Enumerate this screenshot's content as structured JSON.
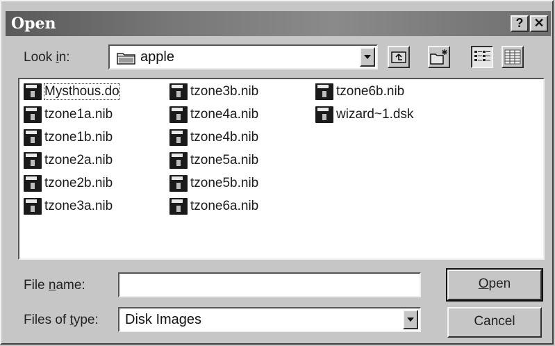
{
  "window": {
    "title": "Open",
    "help_button": "?",
    "close_button": "✕"
  },
  "look_in": {
    "label_prefix": "Look ",
    "label_underlined": "i",
    "label_suffix": "n:",
    "value": "apple",
    "folder_icon": "folder-icon"
  },
  "toolbar": {
    "up_folder_icon": "up-folder-icon",
    "new_folder_icon": "new-folder-icon",
    "list_view_icon": "list-view-icon",
    "details_view_icon": "details-view-icon",
    "list_view_pressed": true
  },
  "files": {
    "columns": [
      [
        "Mysthous.do",
        "tzone1a.nib",
        "tzone1b.nib",
        "tzone2a.nib",
        "tzone2b.nib",
        "tzone3a.nib"
      ],
      [
        "tzone3b.nib",
        "tzone4a.nib",
        "tzone4b.nib",
        "tzone5a.nib",
        "tzone5b.nib",
        "tzone6a.nib"
      ],
      [
        "tzone6b.nib",
        "wizard~1.dsk"
      ]
    ],
    "selected": "Mysthous.do",
    "icon": "disk-image-icon"
  },
  "file_name": {
    "label_prefix": "File ",
    "label_underlined": "n",
    "label_suffix": "ame:",
    "value": ""
  },
  "files_of_type": {
    "label_prefix": "Files of ",
    "label_underlined": "t",
    "label_suffix": "ype:",
    "value": "Disk Images"
  },
  "buttons": {
    "open_underlined": "O",
    "open_rest": "pen",
    "cancel": "Cancel"
  }
}
